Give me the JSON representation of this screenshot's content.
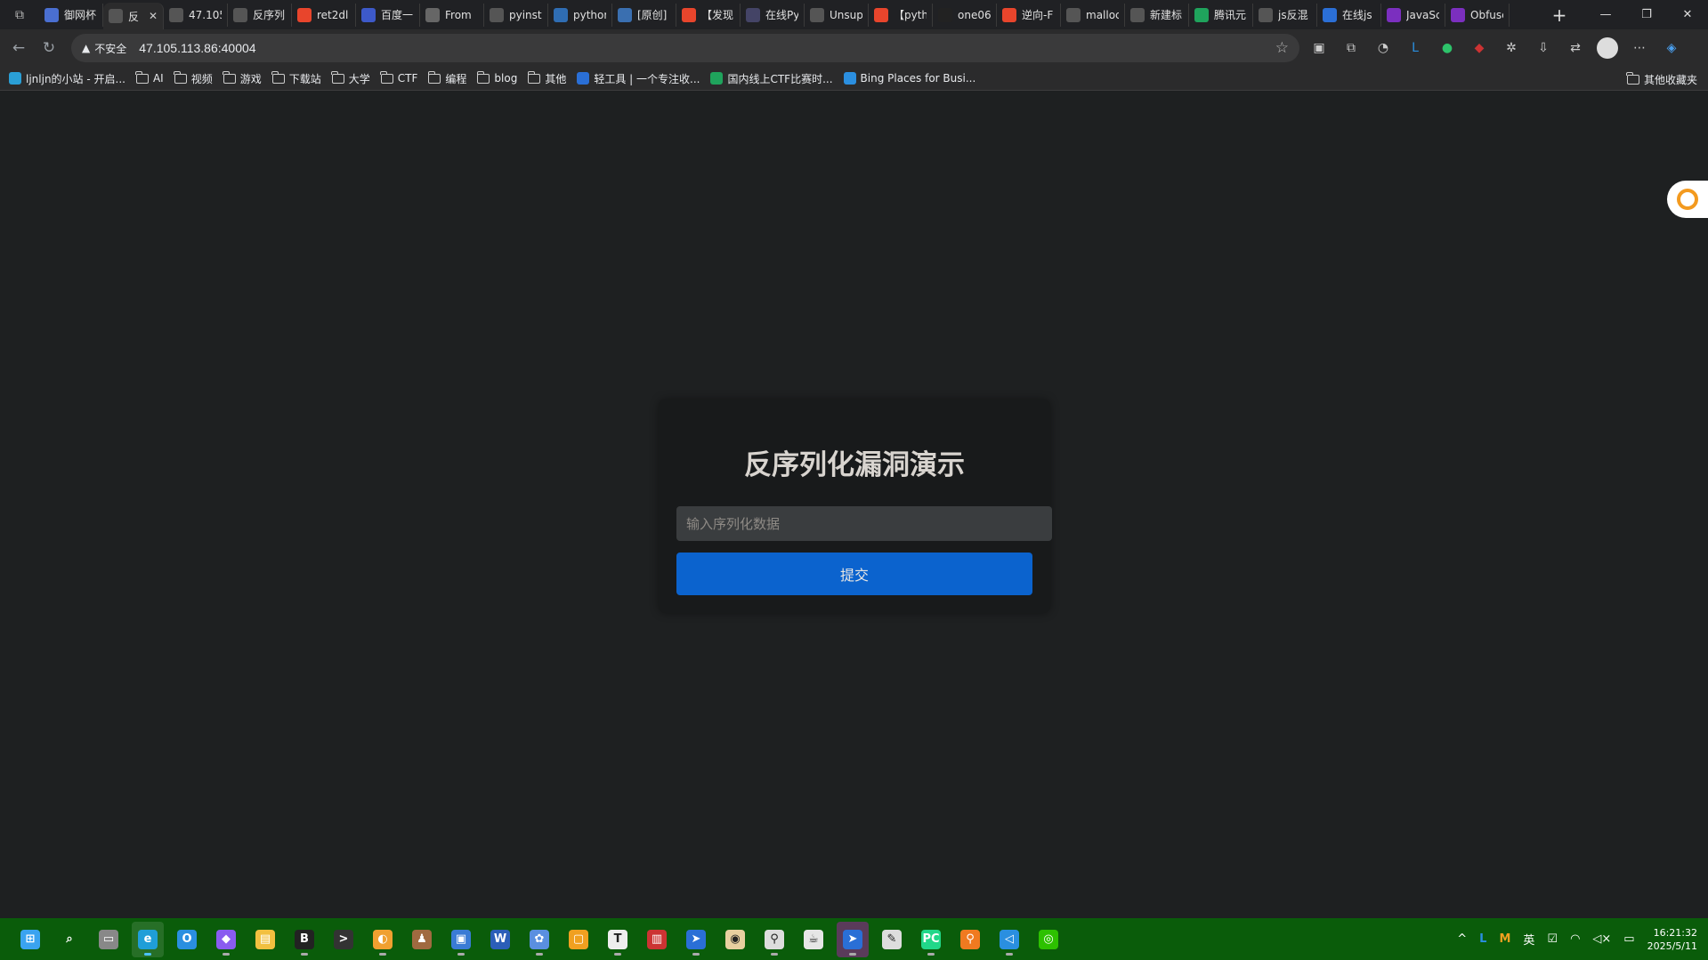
{
  "browser": {
    "tabs": [
      {
        "title": "御网杯",
        "icon": "gear-icon",
        "color": "#4a6fd1"
      },
      {
        "title": "反",
        "icon": "globe-icon",
        "color": "#555",
        "active": true
      },
      {
        "title": "47.105",
        "icon": "globe-icon",
        "color": "#555"
      },
      {
        "title": "反序列",
        "icon": "globe-icon",
        "color": "#555"
      },
      {
        "title": "ret2dl",
        "icon": "csdn-icon",
        "color": "#e8452c"
      },
      {
        "title": "百度一",
        "icon": "baidu-icon",
        "color": "#3d59c9"
      },
      {
        "title": "From",
        "icon": "site-icon",
        "color": "#666"
      },
      {
        "title": "pyinst",
        "icon": "search-icon",
        "color": "#555"
      },
      {
        "title": "pythor",
        "icon": "python-icon",
        "color": "#2f6db3"
      },
      {
        "title": "[原创]",
        "icon": "kanxue-icon",
        "color": "#3a6fb0"
      },
      {
        "title": "【发现",
        "icon": "csdn-icon",
        "color": "#e8452c"
      },
      {
        "title": "在线Py",
        "icon": "gear-icon",
        "color": "#446"
      },
      {
        "title": "Unsup",
        "icon": "search-icon",
        "color": "#555"
      },
      {
        "title": "【pyth",
        "icon": "csdn-icon",
        "color": "#e8452c"
      },
      {
        "title": "one06",
        "icon": "github-icon",
        "color": "#222"
      },
      {
        "title": "逆向-F",
        "icon": "csdn-icon",
        "color": "#e8452c"
      },
      {
        "title": "malloc",
        "icon": "search-icon",
        "color": "#555"
      },
      {
        "title": "新建标",
        "icon": "page-icon",
        "color": "#555"
      },
      {
        "title": "腾讯元",
        "icon": "yuanbao-icon",
        "color": "#1fa35c"
      },
      {
        "title": "js反混",
        "icon": "search-icon",
        "color": "#555"
      },
      {
        "title": "在线js",
        "icon": "b-icon",
        "color": "#2b6fd6"
      },
      {
        "title": "JavaSc",
        "icon": "js-icon",
        "color": "#7b2fbf"
      },
      {
        "title": "Obfusc",
        "icon": "js-icon",
        "color": "#7b2fbf"
      }
    ],
    "address": {
      "warning": "不安全",
      "url": "47.105.113.86:40004"
    },
    "bookmarks": [
      {
        "label": "ljnljn的小站 - 开启...",
        "type": "site"
      },
      {
        "label": "AI",
        "type": "folder"
      },
      {
        "label": "视频",
        "type": "folder"
      },
      {
        "label": "游戏",
        "type": "folder"
      },
      {
        "label": "下载站",
        "type": "folder"
      },
      {
        "label": "大学",
        "type": "folder"
      },
      {
        "label": "CTF",
        "type": "folder"
      },
      {
        "label": "编程",
        "type": "folder"
      },
      {
        "label": "blog",
        "type": "folder"
      },
      {
        "label": "其他",
        "type": "folder"
      },
      {
        "label": "轻工具 | 一个专注收...",
        "type": "site"
      },
      {
        "label": "国内线上CTF比赛时...",
        "type": "site"
      },
      {
        "label": "Bing Places for Busi...",
        "type": "site"
      }
    ],
    "other_bookmarks": "其他收藏夹"
  },
  "page": {
    "title": "反序列化漏洞演示",
    "input_placeholder": "输入序列化数据",
    "input_value": "",
    "submit_label": "提交"
  },
  "taskbar": {
    "apps": [
      {
        "name": "start-icon",
        "color": "#3aa3f0",
        "glyph": "⊞"
      },
      {
        "name": "search-icon",
        "color": "transparent",
        "glyph": "⌕"
      },
      {
        "name": "task-view-icon",
        "color": "#888",
        "glyph": "▭"
      },
      {
        "name": "edge-icon",
        "color": "#1f9ed8",
        "glyph": "e",
        "active": true
      },
      {
        "name": "outlook-icon",
        "color": "#2a8fe0",
        "glyph": "O"
      },
      {
        "name": "app-crystal-icon",
        "color": "#8a5cf0",
        "glyph": "◆"
      },
      {
        "name": "file-explorer-icon",
        "color": "#f2c040",
        "glyph": "▤"
      },
      {
        "name": "bc-icon",
        "color": "#222",
        "glyph": "B"
      },
      {
        "name": "terminal-icon",
        "color": "#333",
        "glyph": ">"
      },
      {
        "name": "app-orange-icon",
        "color": "#f0a030",
        "glyph": "◐"
      },
      {
        "name": "app-figure-icon",
        "color": "#a06a40",
        "glyph": "♟"
      },
      {
        "name": "remote-desktop-icon",
        "color": "#3a7bd5",
        "glyph": "▣"
      },
      {
        "name": "word-icon",
        "color": "#2b5eb8",
        "glyph": "W"
      },
      {
        "name": "app-flower-icon",
        "color": "#5a8fe0",
        "glyph": "✿"
      },
      {
        "name": "app-square-icon",
        "color": "#f0a020",
        "glyph": "▢"
      },
      {
        "name": "typora-icon",
        "color": "#eee",
        "glyph": "T"
      },
      {
        "name": "app-doc-icon",
        "color": "#c33",
        "glyph": "▥"
      },
      {
        "name": "app-arrow-icon",
        "color": "#2a6fd6",
        "glyph": "➤"
      },
      {
        "name": "app-cat-icon",
        "color": "#e8d0a0",
        "glyph": "◉"
      },
      {
        "name": "magnifier-icon",
        "color": "#ddd",
        "glyph": "⚲"
      },
      {
        "name": "java-icon",
        "color": "#e6e6e6",
        "glyph": "☕"
      },
      {
        "name": "app-selected-icon",
        "color": "#2a6fd6",
        "glyph": "➤",
        "selected": true
      },
      {
        "name": "notepad-icon",
        "color": "#ddd",
        "glyph": "✎"
      },
      {
        "name": "pycharm-icon",
        "color": "#21d789",
        "glyph": "PC"
      },
      {
        "name": "search-tool-icon",
        "color": "#f07a20",
        "glyph": "⚲"
      },
      {
        "name": "vscode-icon",
        "color": "#2a8fe0",
        "glyph": "◁"
      },
      {
        "name": "wechat-icon",
        "color": "#2dc100",
        "glyph": "◎"
      }
    ],
    "tray": {
      "ime": "英",
      "time": "16:21:32",
      "date": "2025/5/11"
    }
  }
}
